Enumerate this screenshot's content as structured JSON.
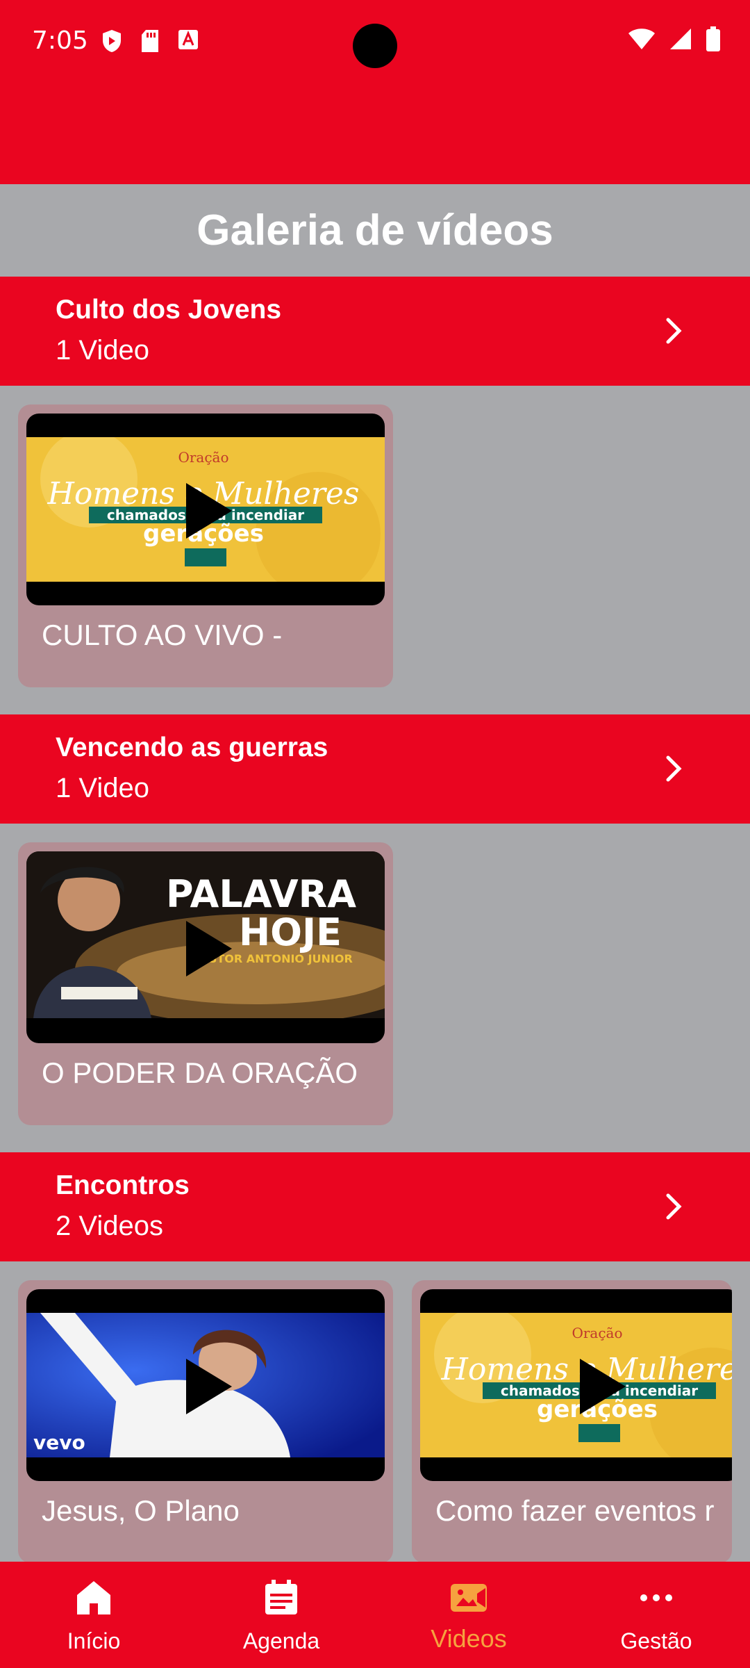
{
  "status_bar": {
    "time": "7:05"
  },
  "page": {
    "title": "Galeria de vídeos"
  },
  "categories": [
    {
      "title": "Culto dos Jovens",
      "count": "1 Video",
      "videos": [
        {
          "title": "CULTO AO VIVO -",
          "thumbnail": "homens-mulheres-poster"
        }
      ]
    },
    {
      "title": "Vencendo as guerras",
      "count": "1 Video",
      "videos": [
        {
          "title": "O PODER DA ORAÇÃO",
          "thumbnail": "palavra-de-hoje-poster"
        }
      ]
    },
    {
      "title": "Encontros",
      "count": "2 Videos",
      "videos": [
        {
          "title": "Jesus, O Plano",
          "thumbnail": "singer-stage-photo"
        },
        {
          "title": "Como fazer eventos r",
          "thumbnail": "homens-mulheres-poster"
        }
      ]
    }
  ],
  "bottom_nav": {
    "items": [
      {
        "label": "Início",
        "icon": "home-icon"
      },
      {
        "label": "Agenda",
        "icon": "calendar-icon"
      },
      {
        "label": "Videos",
        "icon": "video-camera-icon",
        "active": true
      },
      {
        "label": "Gestão",
        "icon": "more-horizontal-icon"
      }
    ]
  },
  "colors": {
    "accent": "#ea0520",
    "background": "#a8a9ac",
    "card": "#b38e94",
    "active_tab": "#f6a23f"
  }
}
